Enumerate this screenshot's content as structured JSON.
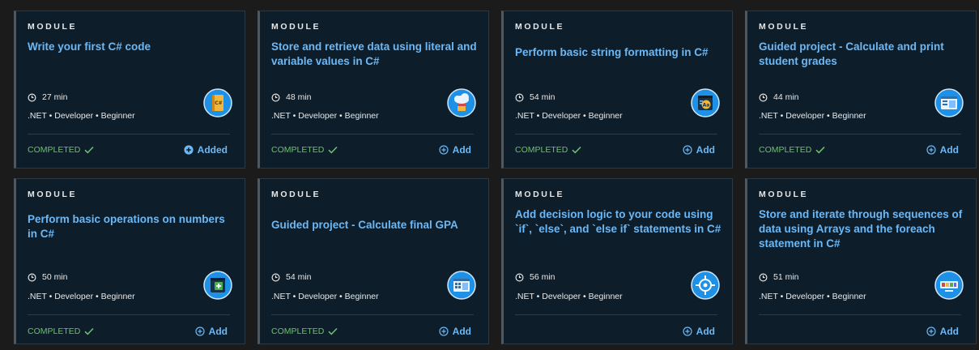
{
  "modules": [
    {
      "eyebrow": "MODULE",
      "title": "Write your first C# code",
      "duration": "27 min",
      "tags": ".NET • Developer • Beginner",
      "status": "COMPLETED",
      "action_label": "Added",
      "action_state": "added",
      "icon": "csharp-book-icon"
    },
    {
      "eyebrow": "MODULE",
      "title": "Store and retrieve data using literal and variable values in C#",
      "duration": "48 min",
      "tags": ".NET • Developer • Beginner",
      "status": "COMPLETED",
      "action_label": "Add",
      "action_state": "add",
      "icon": "cloud-storage-icon"
    },
    {
      "eyebrow": "MODULE",
      "title": "Perform basic string formatting in C#",
      "duration": "54 min",
      "tags": ".NET • Developer • Beginner",
      "status": "COMPLETED",
      "action_label": "Add",
      "action_state": "add",
      "icon": "string-format-icon"
    },
    {
      "eyebrow": "MODULE",
      "title": "Guided project - Calculate and print student grades",
      "duration": "44 min",
      "tags": ".NET • Developer • Beginner",
      "status": "COMPLETED",
      "action_label": "Add",
      "action_state": "add",
      "icon": "report-window-icon"
    },
    {
      "eyebrow": "MODULE",
      "title": "Perform basic operations on numbers in C#",
      "duration": "50 min",
      "tags": ".NET • Developer • Beginner",
      "status": "COMPLETED",
      "action_label": "Add",
      "action_state": "add",
      "icon": "plus-terminal-icon"
    },
    {
      "eyebrow": "MODULE",
      "title": "Guided project - Calculate final GPA",
      "duration": "54 min",
      "tags": ".NET • Developer • Beginner",
      "status": "COMPLETED",
      "action_label": "Add",
      "action_state": "add",
      "icon": "calculator-window-icon"
    },
    {
      "eyebrow": "MODULE",
      "title": "Add decision logic to your code using `if`, `else`, and `else if` statements in C#",
      "duration": "56 min",
      "tags": ".NET • Developer • Beginner",
      "status": "",
      "action_label": "Add",
      "action_state": "add",
      "icon": "decision-target-icon"
    },
    {
      "eyebrow": "MODULE",
      "title": "Store and iterate through sequences of data using Arrays and the foreach statement in C#",
      "duration": "51 min",
      "tags": ".NET • Developer • Beginner",
      "status": "",
      "action_label": "Add",
      "action_state": "add",
      "icon": "array-blocks-icon"
    }
  ],
  "colors": {
    "card_background": "#0d1e2a",
    "title": "#6cb8f6",
    "completed": "#6fbf6f",
    "badge_blue": "#1e90e6"
  }
}
